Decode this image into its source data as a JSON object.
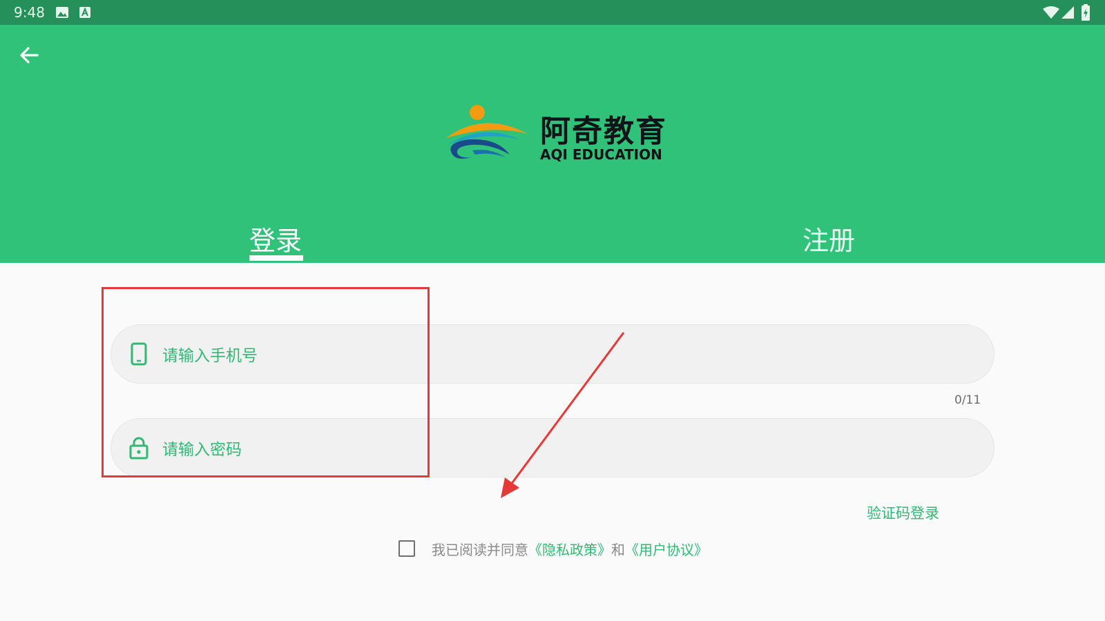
{
  "status_bar": {
    "time": "9:48",
    "icons": [
      "image-icon",
      "keyboard-a-icon",
      "wifi-icon",
      "cell-signal-icon",
      "battery-icon"
    ]
  },
  "header": {
    "logo_cn": "阿奇教育",
    "logo_en": "AQI EDUCATION"
  },
  "tabs": [
    {
      "label": "登录",
      "active": true
    },
    {
      "label": "注册",
      "active": false
    }
  ],
  "form": {
    "phone_placeholder": "请输入手机号",
    "phone_counter": "0/11",
    "password_placeholder": "请输入密码",
    "sms_login": "验证码登录"
  },
  "agreement": {
    "prefix": "我已阅读并同意",
    "privacy_link": "《隐私政策》",
    "conjunction": "和",
    "terms_link": "《用户协议》",
    "checked": false
  },
  "colors": {
    "header": "#31c27a",
    "status_bar": "#24905a",
    "accent": "#31b873",
    "annotation": "#e53935"
  }
}
